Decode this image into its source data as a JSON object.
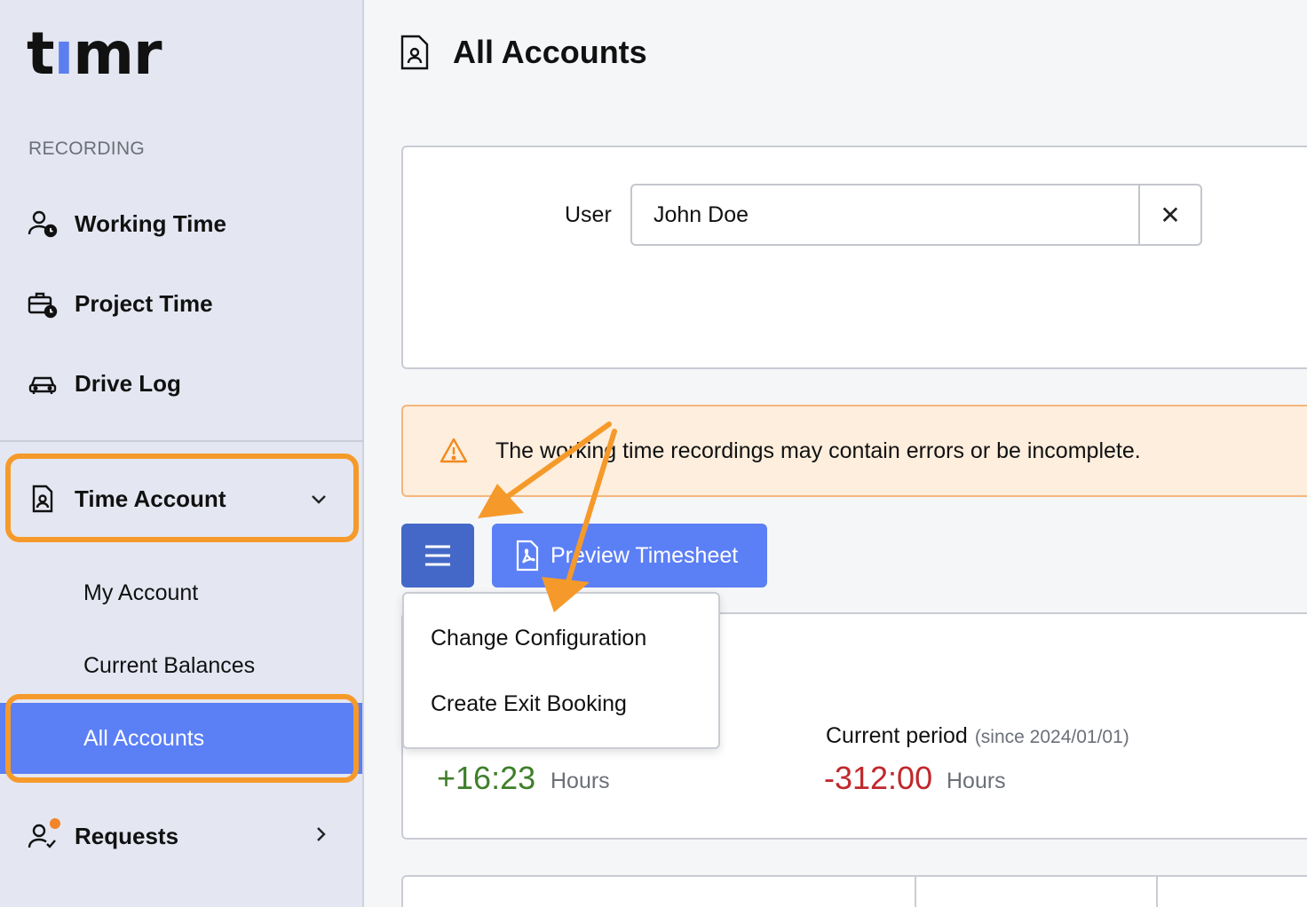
{
  "brand": {
    "logo_prefix": "t",
    "logo_accent": "ı",
    "logo_suffix": "mr",
    "accent_color": "#5b7fef"
  },
  "sidebar": {
    "section_label": "RECORDING",
    "items": [
      {
        "label": "Working Time",
        "icon": "user-clock-icon"
      },
      {
        "label": "Project Time",
        "icon": "briefcase-clock-icon"
      },
      {
        "label": "Drive Log",
        "icon": "car-icon"
      }
    ],
    "time_account": {
      "label": "Time Account",
      "icon": "document-user-icon",
      "expanded": true
    },
    "sub_items": [
      {
        "label": "My Account",
        "active": false
      },
      {
        "label": "Current Balances",
        "active": false
      },
      {
        "label": "All Accounts",
        "active": true
      }
    ],
    "requests": {
      "label": "Requests",
      "icon": "user-check-icon",
      "has_notification": true
    }
  },
  "header": {
    "title": "All Accounts",
    "icon": "document-user-icon"
  },
  "filter": {
    "user_label": "User",
    "user_value": "John Doe",
    "clear_icon": "close-icon"
  },
  "warning": {
    "text": "The working time recordings may contain errors or be incomplete.",
    "icon": "warning-triangle-icon"
  },
  "actions": {
    "menu_icon": "hamburger-icon",
    "preview_label": "Preview Timesheet",
    "preview_icon": "pdf-file-icon"
  },
  "dropdown": {
    "items": [
      "Change Configuration",
      "Create Exit Booking"
    ]
  },
  "balances": {
    "total": {
      "value": "+16:23",
      "unit": "Hours",
      "color": "#3f7f2a"
    },
    "current_period": {
      "label": "Current period",
      "since": "(since 2024/01/01)",
      "value": "-312:00",
      "unit": "Hours",
      "color": "#c0282c"
    }
  },
  "colors": {
    "highlight": "#f59a2a",
    "primary": "#5b7ff5",
    "primary_dark": "#4468c7",
    "warning_bg": "#feeedd"
  }
}
